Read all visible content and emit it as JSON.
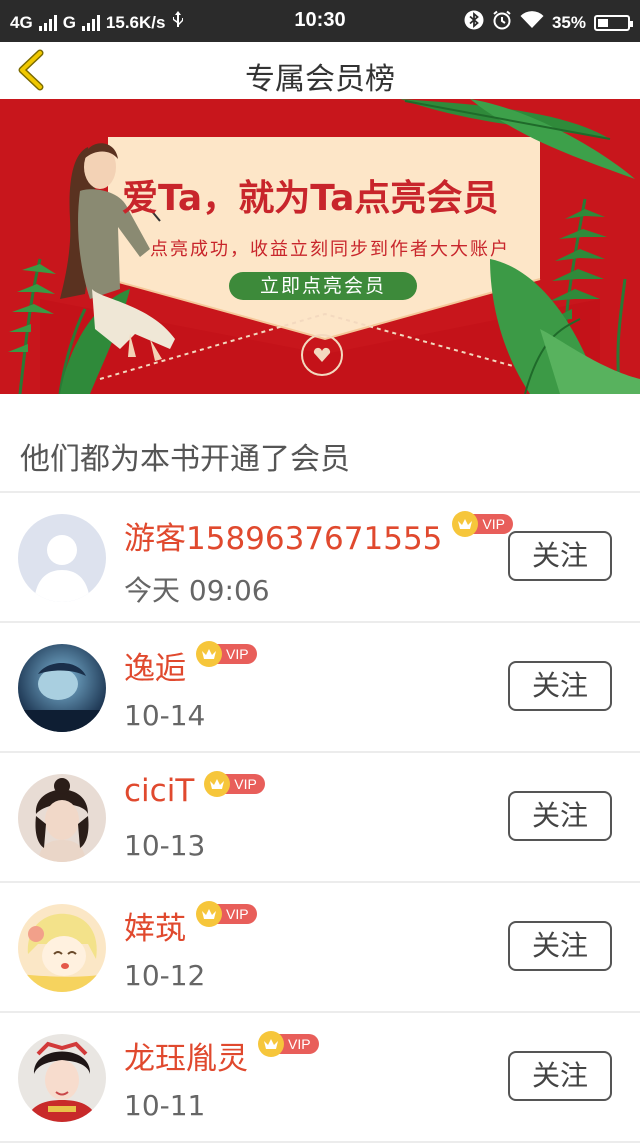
{
  "status_bar": {
    "network1": "4G",
    "network2": "G",
    "speed": "15.6K/s",
    "usb_icon": "usb-icon",
    "time": "10:30",
    "battery_percent": "35%",
    "battery_level": 0.35
  },
  "header": {
    "back_icon": "chevron-left-icon",
    "title": "专属会员榜"
  },
  "banner": {
    "title": "爱Ta，就为Ta点亮会员",
    "subtitle": "点亮成功，收益立刻同步到作者大大账户",
    "button_label": "立即点亮会员"
  },
  "section_title": "他们都为本书开通了会员",
  "members": [
    {
      "name": "游客1589637671555",
      "badge": "VIP",
      "date": "今天 09:06",
      "follow_label": "关注"
    },
    {
      "name": "逸逅",
      "badge": "VIP",
      "date": "10-14",
      "follow_label": "关注"
    },
    {
      "name": "ciciT",
      "badge": "VIP",
      "date": "10-13",
      "follow_label": "关注"
    },
    {
      "name": "婞茿",
      "badge": "VIP",
      "date": "10-12",
      "follow_label": "关注"
    },
    {
      "name": "龙珏胤灵",
      "badge": "VIP",
      "date": "10-11",
      "follow_label": "关注"
    }
  ],
  "colors": {
    "accent_name": "#e0492e",
    "banner_red": "#c8252b",
    "banner_button": "#3d8a3a",
    "vip_tag": "#e85e5a",
    "crown": "#f6c63b",
    "back_arrow": "#d9b300"
  }
}
